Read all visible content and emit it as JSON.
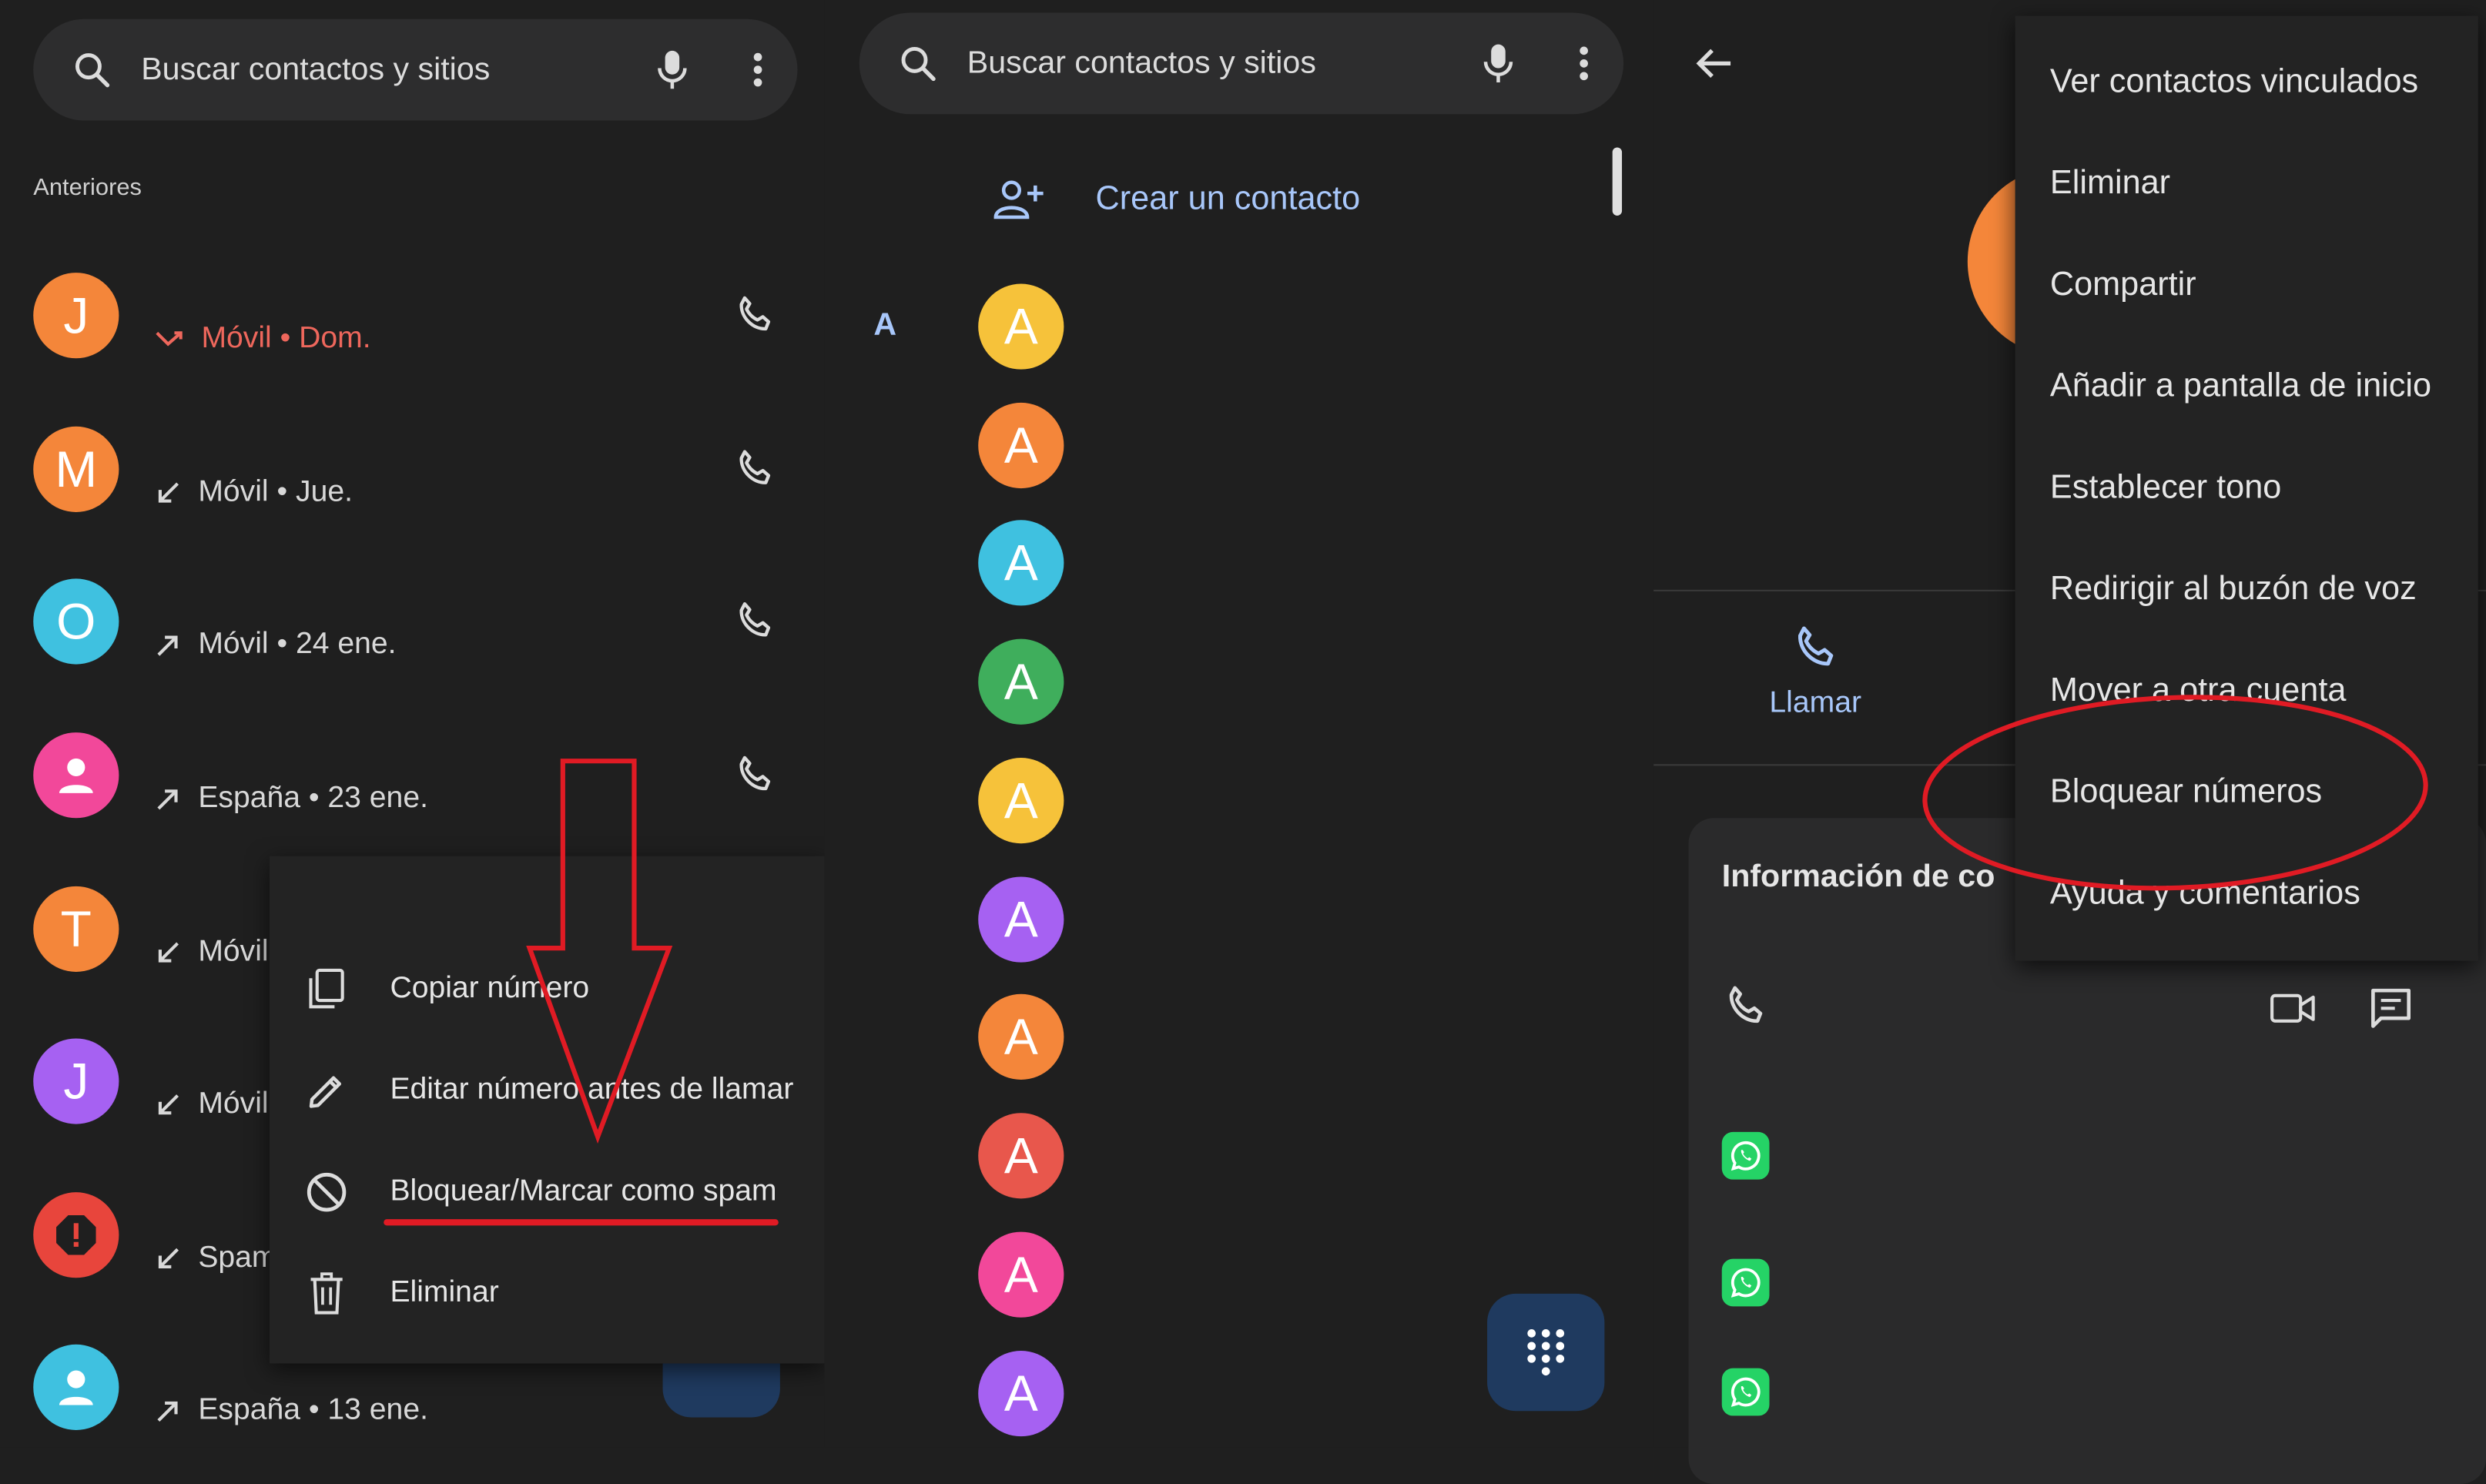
{
  "colors": {
    "bg": "#1f1f1f",
    "surface": "#2d2d2e",
    "accent_blue": "#a8c7fa",
    "missed_red": "#ee675c",
    "annotation_red": "#e01b24",
    "fab": "#1f3a5f"
  },
  "left": {
    "search_placeholder": "Buscar contactos y sitios",
    "section_label": "Anteriores",
    "calls": [
      {
        "initial": "J",
        "color": "#f4863a",
        "text": "Móvil • Dom.",
        "direction": "missed"
      },
      {
        "initial": "M",
        "color": "#f4863a",
        "text": "Móvil • Jue.",
        "direction": "incoming"
      },
      {
        "initial": "O",
        "color": "#3fc1e0",
        "text": "Móvil • 24 ene.",
        "direction": "outgoing"
      },
      {
        "initial": "",
        "color": "#f2489a",
        "text": "España • 23 ene.",
        "direction": "outgoing",
        "icon": "person-icon"
      },
      {
        "initial": "T",
        "color": "#f4863a",
        "text": "Móvil",
        "direction": "incoming"
      },
      {
        "initial": "J",
        "color": "#a661f2",
        "text": "Móvil",
        "direction": "incoming"
      },
      {
        "initial": "",
        "color": "#e8453c",
        "text": "Spam",
        "direction": "incoming",
        "icon": "spam-warning-icon"
      },
      {
        "initial": "",
        "color": "#3fc1e0",
        "text": "España • 13 ene.",
        "direction": "outgoing",
        "icon": "person-icon"
      }
    ],
    "context_menu": [
      {
        "label": "Copiar número",
        "icon": "copy-icon"
      },
      {
        "label": "Editar número antes de llamar",
        "icon": "edit-icon"
      },
      {
        "label": "Bloquear/Marcar como spam",
        "icon": "block-icon"
      },
      {
        "label": "Eliminar",
        "icon": "trash-icon"
      }
    ]
  },
  "middle": {
    "search_placeholder": "Buscar contactos y sitios",
    "create_contact": "Crear un contacto",
    "letter_header": "A",
    "contacts": [
      {
        "initial": "A",
        "color": "#f6c23a"
      },
      {
        "initial": "A",
        "color": "#f4863a"
      },
      {
        "initial": "A",
        "color": "#3fc1e0"
      },
      {
        "initial": "A",
        "color": "#3fae5c"
      },
      {
        "initial": "A",
        "color": "#f6c23a"
      },
      {
        "initial": "A",
        "color": "#a661f2"
      },
      {
        "initial": "A",
        "color": "#f4863a"
      },
      {
        "initial": "A",
        "color": "#e8574c"
      },
      {
        "initial": "A",
        "color": "#f2489a"
      },
      {
        "initial": "A",
        "color": "#a661f2"
      }
    ]
  },
  "right": {
    "call_label": "Llamar",
    "info_title": "Información de co",
    "overflow_menu": [
      "Ver contactos vinculados",
      "Eliminar",
      "Compartir",
      "Añadir a pantalla de inicio",
      "Establecer tono",
      "Redirigir al buzón de voz",
      "Mover a otra cuenta",
      "Bloquear números",
      "Ayuda y comentarios"
    ]
  }
}
